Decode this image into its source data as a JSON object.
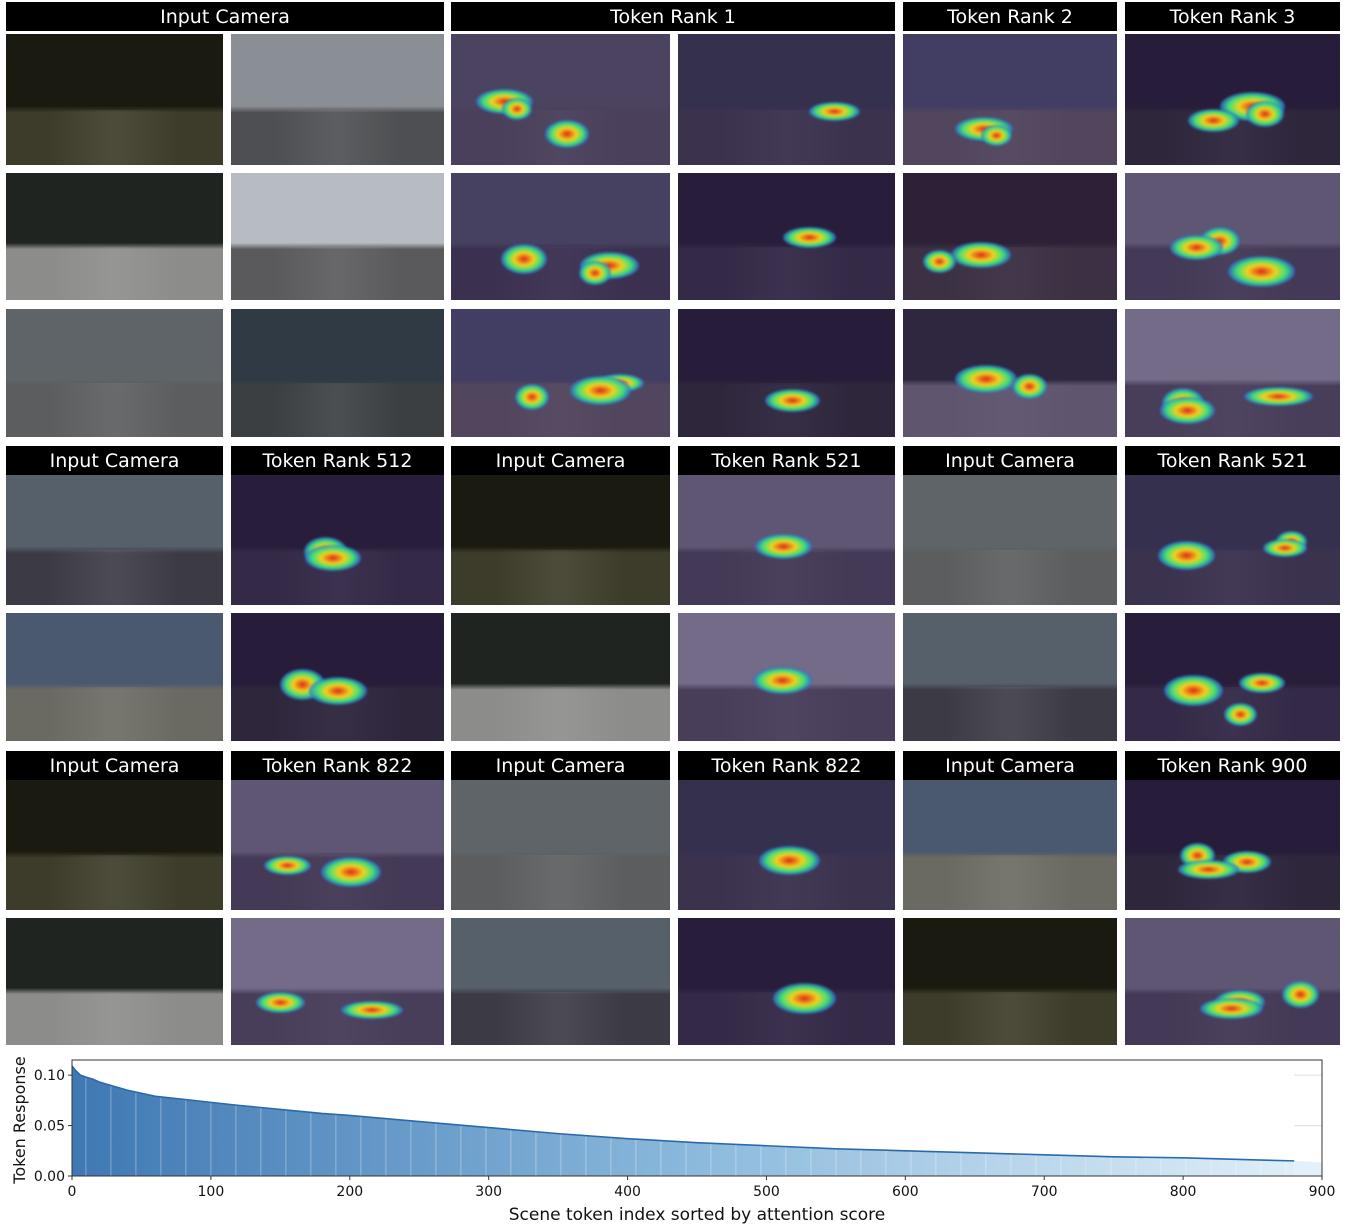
{
  "figure": {
    "headers_top": [
      "Input Camera",
      "Token Rank 1",
      "Token Rank 2",
      "Token Rank 3"
    ],
    "panels": [
      {
        "camera_label": "Input Camera",
        "rank_label": "Token Rank 512"
      },
      {
        "camera_label": "Input Camera",
        "rank_label": "Token Rank 521"
      },
      {
        "camera_label": "Input Camera",
        "rank_label": "Token Rank 521"
      },
      {
        "camera_label": "Input Camera",
        "rank_label": "Token Rank 822"
      },
      {
        "camera_label": "Input Camera",
        "rank_label": "Token Rank 822"
      },
      {
        "camera_label": "Input Camera",
        "rank_label": "Token Rank 900"
      }
    ]
  },
  "chart_data": {
    "type": "area",
    "xlabel": "Scene token index sorted by attention score",
    "ylabel": "Token Response",
    "xlim": [
      0,
      900
    ],
    "ylim": [
      0.0,
      0.115
    ],
    "xticks": [
      0,
      100,
      200,
      300,
      400,
      500,
      600,
      700,
      800,
      900
    ],
    "yticks": [
      0.0,
      0.05,
      0.1
    ],
    "ytick_labels": [
      "0.00",
      "0.05",
      "0.10"
    ],
    "grid": true,
    "series": [
      {
        "x": [
          0,
          3,
          6,
          10,
          15,
          20,
          30,
          40,
          50,
          60,
          80,
          100,
          120,
          150,
          180,
          200,
          250,
          300,
          350,
          400,
          450,
          500,
          550,
          600,
          650,
          700,
          750,
          800,
          850,
          880
        ],
        "y": [
          0.109,
          0.104,
          0.1,
          0.098,
          0.096,
          0.093,
          0.089,
          0.085,
          0.082,
          0.079,
          0.076,
          0.073,
          0.07,
          0.066,
          0.062,
          0.06,
          0.054,
          0.048,
          0.042,
          0.037,
          0.033,
          0.03,
          0.027,
          0.025,
          0.023,
          0.021,
          0.019,
          0.018,
          0.016,
          0.015
        ]
      }
    ],
    "colors": {
      "line": "#2b6aa8",
      "fill_dark": "#4f86bd",
      "fill_light": "#dbe9f5"
    }
  }
}
